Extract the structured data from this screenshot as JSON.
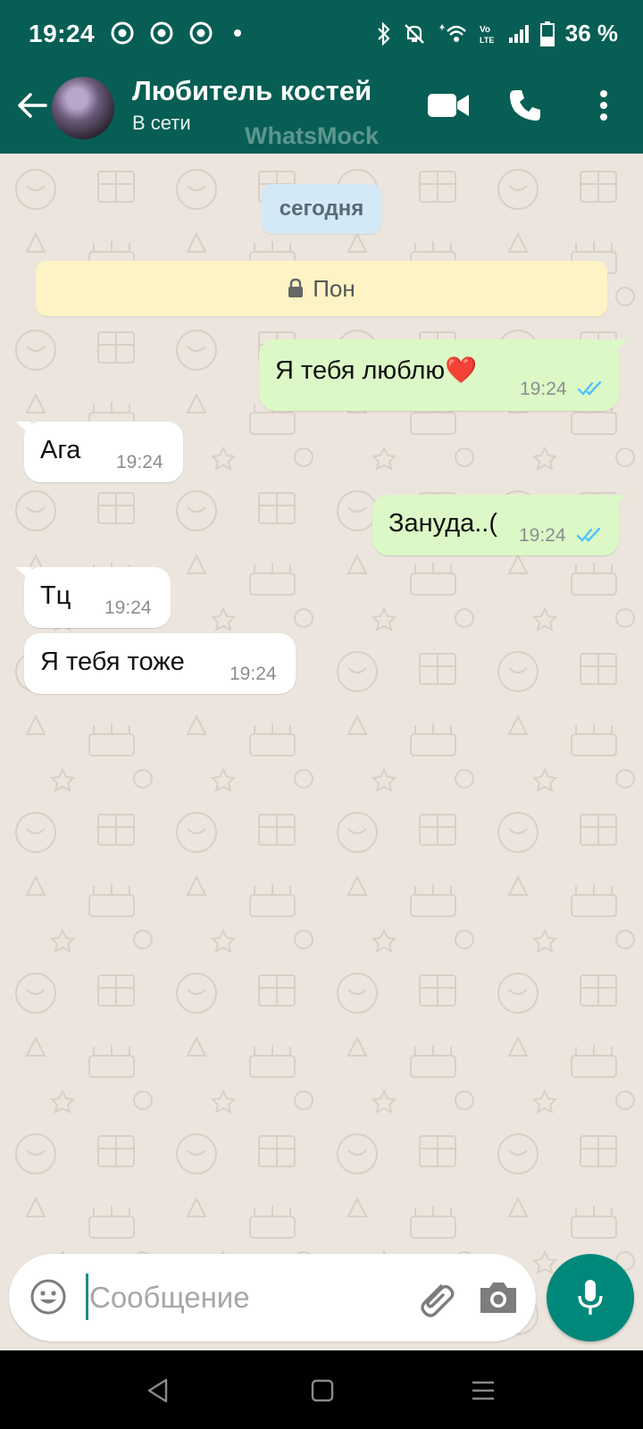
{
  "status_bar": {
    "time": "19:24",
    "battery": "36 %"
  },
  "header": {
    "contact_name": "Любитель костей",
    "contact_status": "В сети",
    "watermark": "WhatsMock"
  },
  "chat": {
    "date_label": "сегодня",
    "encryption_banner": "Пон",
    "messages": [
      {
        "direction": "out",
        "text": "Я тебя люблю❤️",
        "time": "19:24",
        "status": "read"
      },
      {
        "direction": "in",
        "text": "Ага",
        "time": "19:24"
      },
      {
        "direction": "out",
        "text": "Зануда..(",
        "time": "19:24",
        "status": "read"
      },
      {
        "direction": "in",
        "text": "Тц",
        "time": "19:24"
      },
      {
        "direction": "in",
        "text": "Я тебя тоже",
        "time": "19:24"
      }
    ]
  },
  "composer": {
    "placeholder": "Сообщение",
    "value": ""
  },
  "colors": {
    "header": "#075E54",
    "chat_background": "#ECE5DD",
    "outgoing_bubble": "#DCF8C6",
    "incoming_bubble": "#FFFFFF",
    "read_ticks": "#4FC3F7",
    "mic_button": "#00897B"
  },
  "icons": {
    "back": "arrow-left-icon",
    "video": "video-camera-icon",
    "call": "phone-icon",
    "menu": "more-vertical-icon",
    "emoji": "emoji-icon",
    "attach": "paperclip-icon",
    "camera": "camera-icon",
    "mic": "microphone-icon",
    "lock": "lock-icon"
  }
}
